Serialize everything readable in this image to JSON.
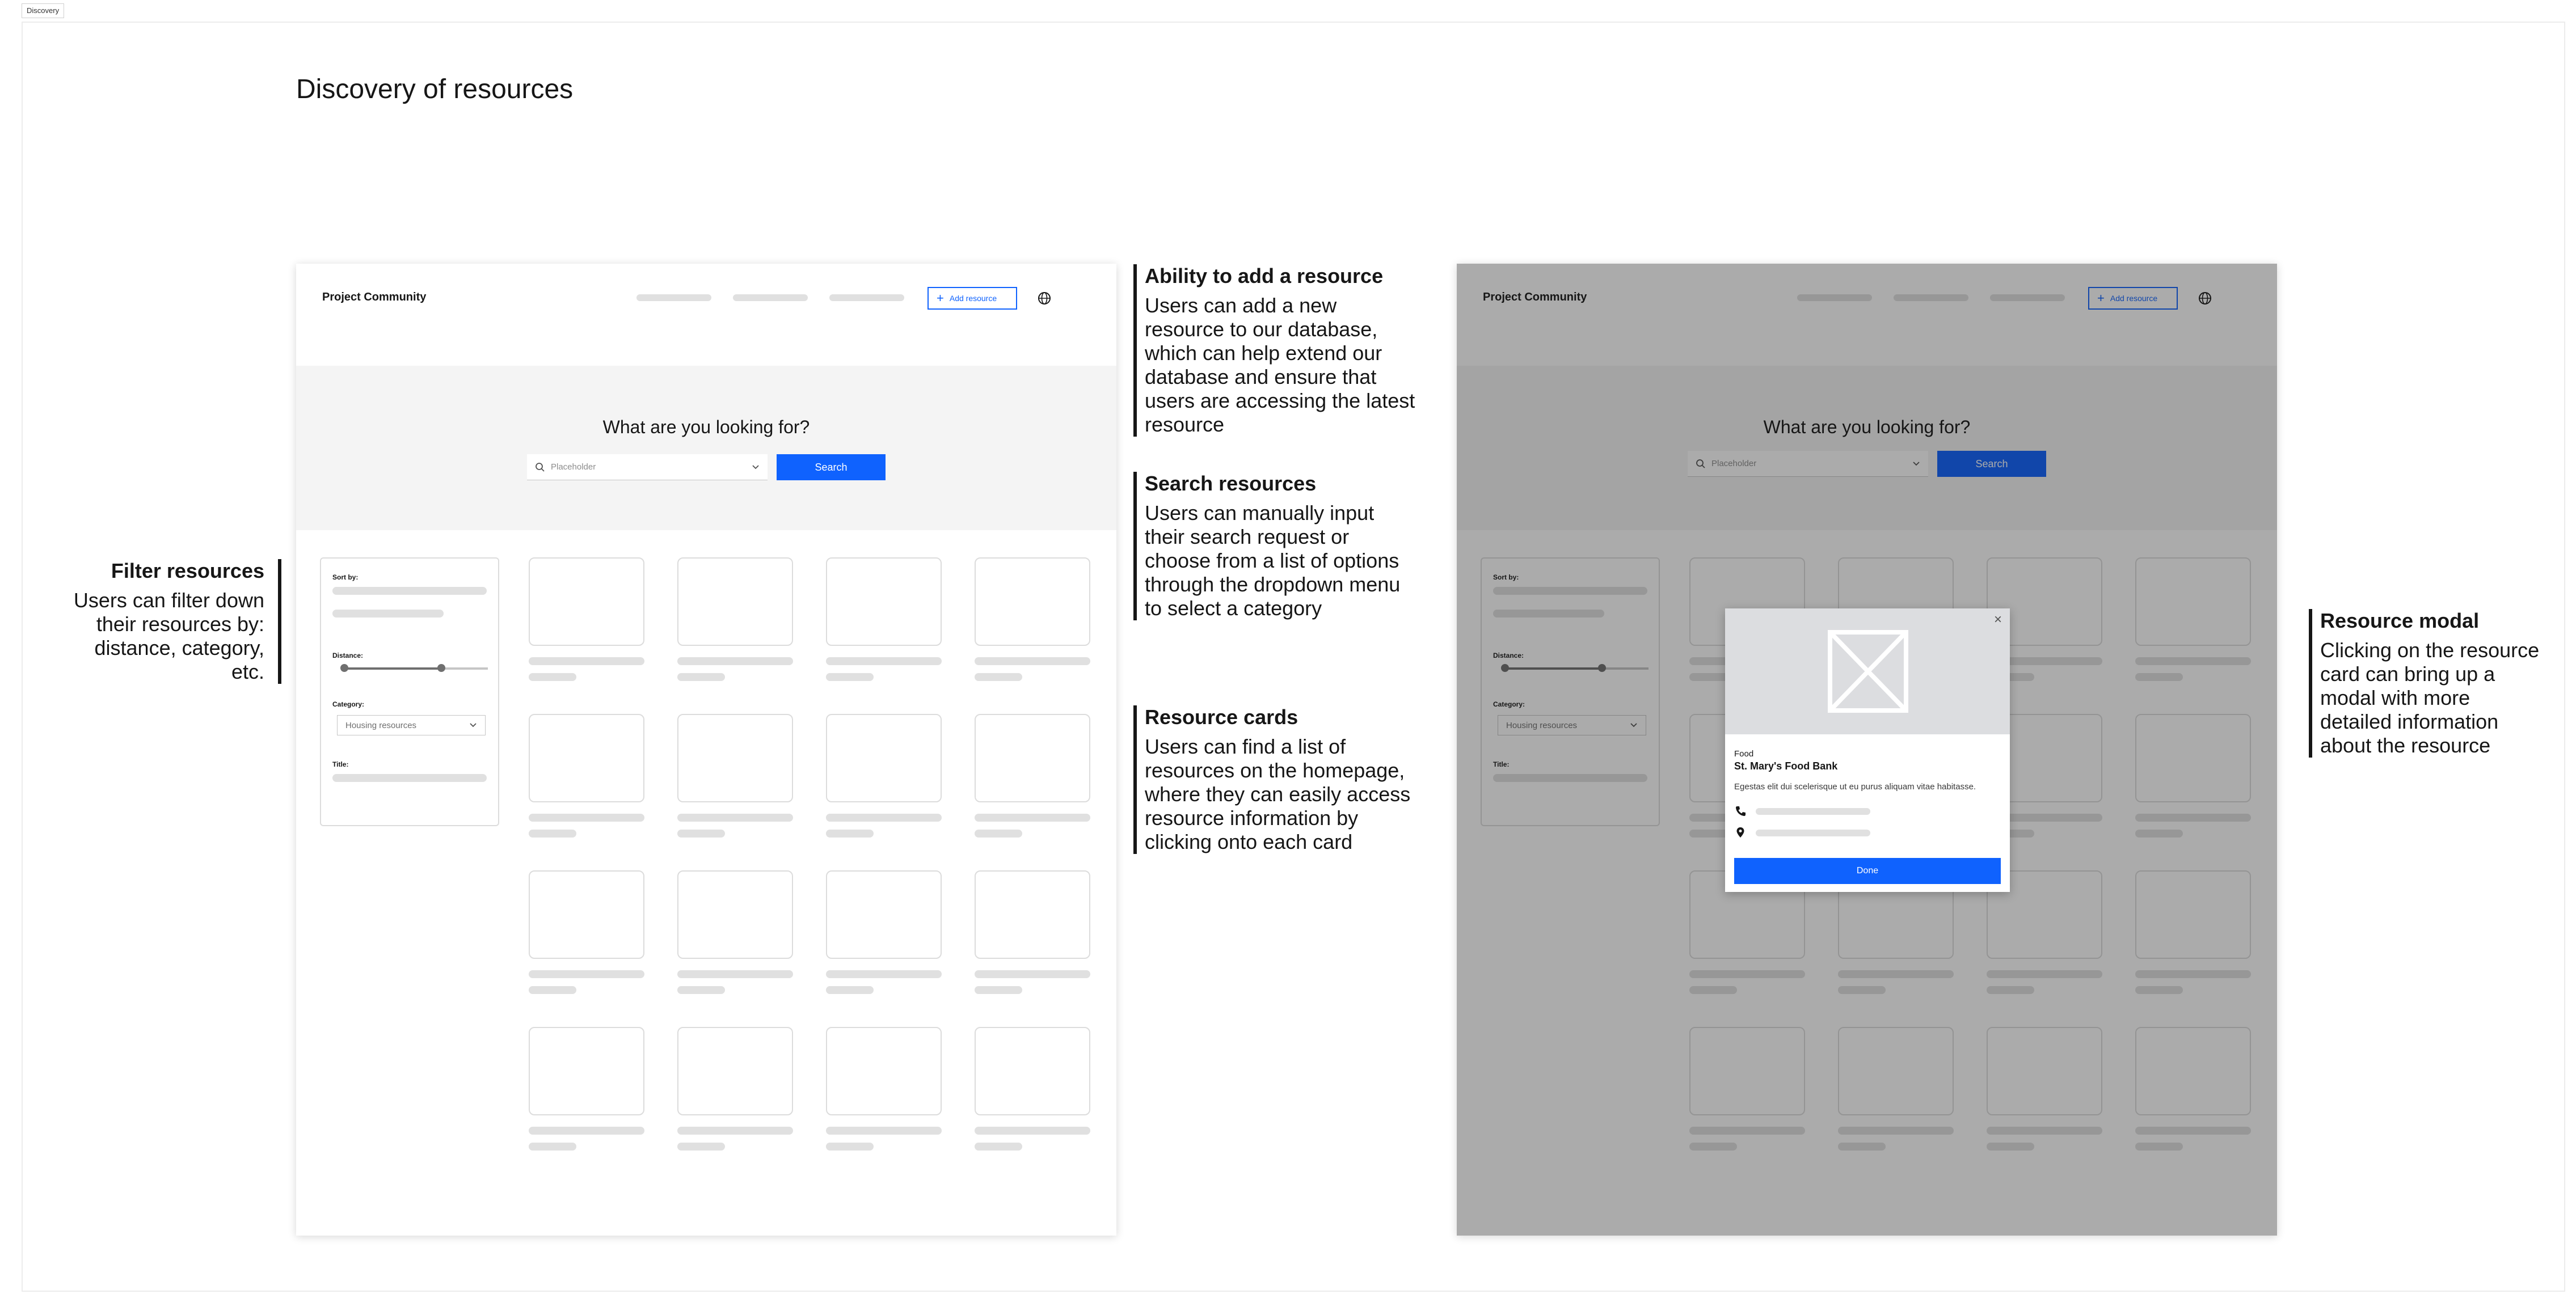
{
  "frame_label": "Discovery",
  "page_title": "Discovery of resources",
  "mockup": {
    "brand": "Project Community",
    "add_resource_label": "Add resource",
    "hero_question": "What are you looking for?",
    "search_placeholder": "Placeholder",
    "search_button": "Search",
    "filters": {
      "sort_by_label": "Sort by:",
      "distance_label": "Distance:",
      "distance_value_fraction": 0.68,
      "category_label": "Category:",
      "category_selected": "Housing resources",
      "title_label": "Title:"
    }
  },
  "modal": {
    "category": "Food",
    "name": "St. Mary's Food Bank",
    "description": "Egestas elit dui scelerisque ut eu purus aliquam vitae habitasse.",
    "done_button": "Done"
  },
  "annotations": {
    "add_resource": {
      "title": "Ability to add a resource",
      "body": "Users can add a new resource to our database, which can help extend our database and ensure that users are accessing the latest resource"
    },
    "search": {
      "title": "Search resources",
      "body": "Users can manually input their search request or choose from a list of options through the dropdown menu to select a category"
    },
    "cards": {
      "title": "Resource cards",
      "body": "Users can find a list of resources on the homepage, where they can easily access resource information by clicking onto each card"
    },
    "filter": {
      "title": "Filter resources",
      "body": "Users can filter down their resources by: distance, category, etc."
    },
    "modal": {
      "title": "Resource modal",
      "body": "Clicking on the resource card can bring up a modal with more detailed information about the resource"
    }
  },
  "colors": {
    "primary": "#0f62fe",
    "skeleton": "#e0e0e0",
    "hero_bg": "#f4f4f4",
    "text": "#161616"
  }
}
